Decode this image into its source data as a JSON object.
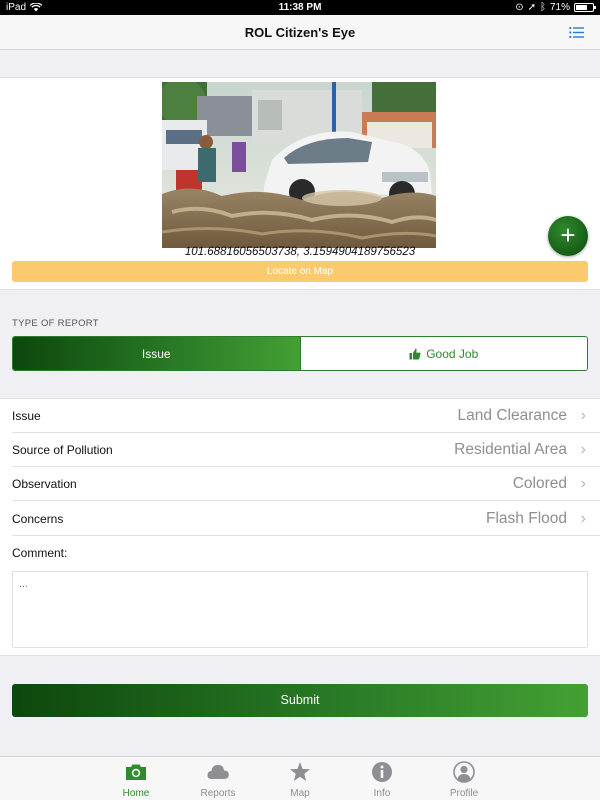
{
  "status": {
    "device": "iPad",
    "time": "11:38 PM",
    "battery": "71%",
    "battery_level": 0.71
  },
  "nav": {
    "title": "ROL Citizen's Eye",
    "menu_icon": "list-menu-icon"
  },
  "photo": {
    "coordinates": "101.68816056503738, 3.1594904189756523",
    "add_icon": "plus-icon",
    "locate_label": "Locate on Map"
  },
  "report_type": {
    "label": "TYPE OF REPORT",
    "options": [
      "Issue",
      "Good Job"
    ],
    "selected": "Issue",
    "good_icon": "thumbs-up-icon"
  },
  "form": {
    "rows": [
      {
        "label": "Issue",
        "value": "Land Clearance"
      },
      {
        "label": "Source of Pollution",
        "value": "Residential Area"
      },
      {
        "label": "Observation",
        "value": "Colored"
      },
      {
        "label": "Concerns",
        "value": "Flash Flood"
      }
    ],
    "comment_label": "Comment:",
    "comment_placeholder": "..."
  },
  "submit_label": "Submit",
  "tabs": [
    {
      "label": "Home",
      "icon": "camera-icon",
      "active": true
    },
    {
      "label": "Reports",
      "icon": "cloud-icon",
      "active": false
    },
    {
      "label": "Map",
      "icon": "star-icon",
      "active": false
    },
    {
      "label": "Info",
      "icon": "info-icon",
      "active": false
    },
    {
      "label": "Profile",
      "icon": "profile-icon",
      "active": false
    }
  ],
  "colors": {
    "accent_green": "#2e8b2e",
    "dark_green": "#0d470d",
    "locate_yellow": "#fcca6e"
  }
}
